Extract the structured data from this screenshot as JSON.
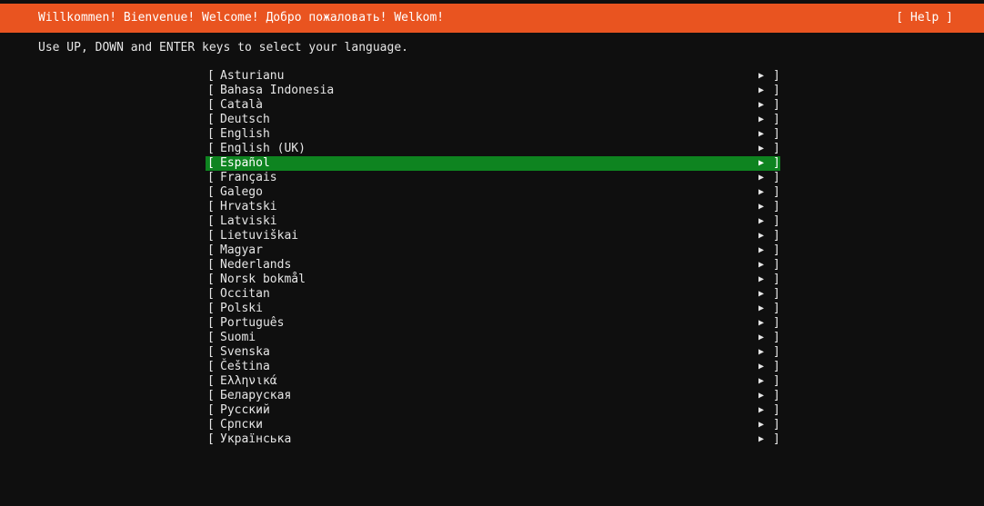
{
  "header": {
    "title": "Willkommen! Bienvenue! Welcome! Добро пожаловать! Welkom!",
    "help_label": "[ Help ]",
    "background_color": "#e95420"
  },
  "instructions": "Use UP, DOWN and ENTER keys to select your language.",
  "selected_color": "#0e8420",
  "list": {
    "left_bracket": "[",
    "right_bracket": "]",
    "arrow_icon": "▶",
    "selected_index": 6,
    "items": [
      "Asturianu",
      "Bahasa Indonesia",
      "Català",
      "Deutsch",
      "English",
      "English (UK)",
      "Español",
      "Français",
      "Galego",
      "Hrvatski",
      "Latviski",
      "Lietuviškai",
      "Magyar",
      "Nederlands",
      "Norsk bokmål",
      "Occitan",
      "Polski",
      "Português",
      "Suomi",
      "Svenska",
      "Čeština",
      "Ελληνικά",
      "Беларуская",
      "Русский",
      "Српски",
      "Українська"
    ]
  }
}
